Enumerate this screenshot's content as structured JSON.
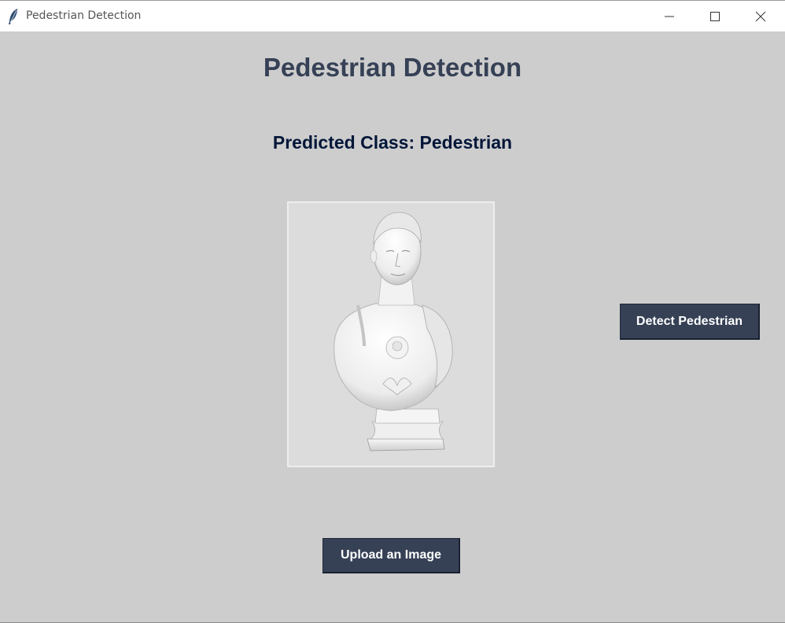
{
  "window": {
    "title": "Pedestrian Detection"
  },
  "main": {
    "heading": "Pedestrian Detection",
    "prediction_text": "Predicted Class: Pedestrian",
    "detect_button_label": "Detect Pedestrian",
    "upload_button_label": "Upload an Image"
  },
  "icons": {
    "app": "feather-icon",
    "minimize": "minimize-icon",
    "maximize": "maximize-icon",
    "close": "close-icon"
  },
  "colors": {
    "background": "#cdcdcd",
    "heading": "#364156",
    "prediction": "#011638",
    "button": "#364156",
    "button_text": "#ffffff"
  }
}
